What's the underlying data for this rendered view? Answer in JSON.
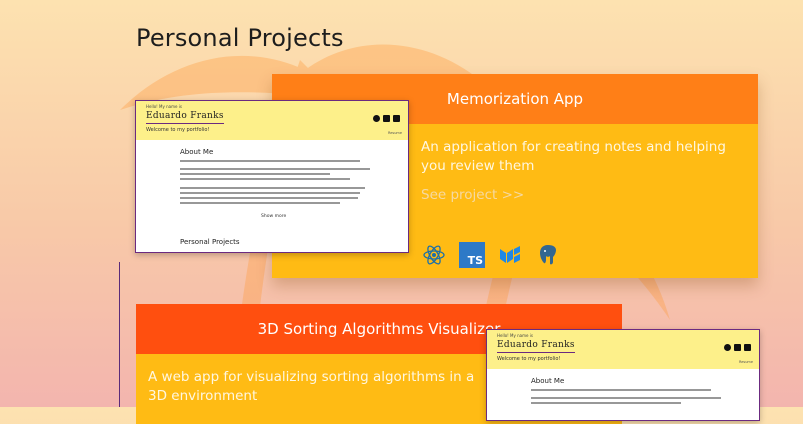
{
  "section": {
    "title": "Personal Projects"
  },
  "colors": {
    "accent_orange": "#ff7f17",
    "accent_red": "#ff4f0f",
    "card_yellow": "#ffbb14"
  },
  "projects": [
    {
      "title": "Memorization App",
      "description": "An application for creating notes and helping you review them",
      "link_label": "See project >>",
      "technologies": [
        "react-icon",
        "typescript-icon",
        "mui-icon",
        "postgresql-icon"
      ],
      "tech_labels": [
        "TS"
      ]
    },
    {
      "title": "3D Sorting Algorithms Visualizer",
      "description": "A web app for visualizing sorting algorithms in a 3D environment"
    }
  ],
  "preview": {
    "tiny_text": "Hello! My name is",
    "name": "Eduardo Franks",
    "welcome": "Welcome to my portfolio!",
    "resume": "Resume",
    "about_heading": "About Me",
    "show_more": "Show more",
    "projects_heading": "Personal Projects"
  }
}
